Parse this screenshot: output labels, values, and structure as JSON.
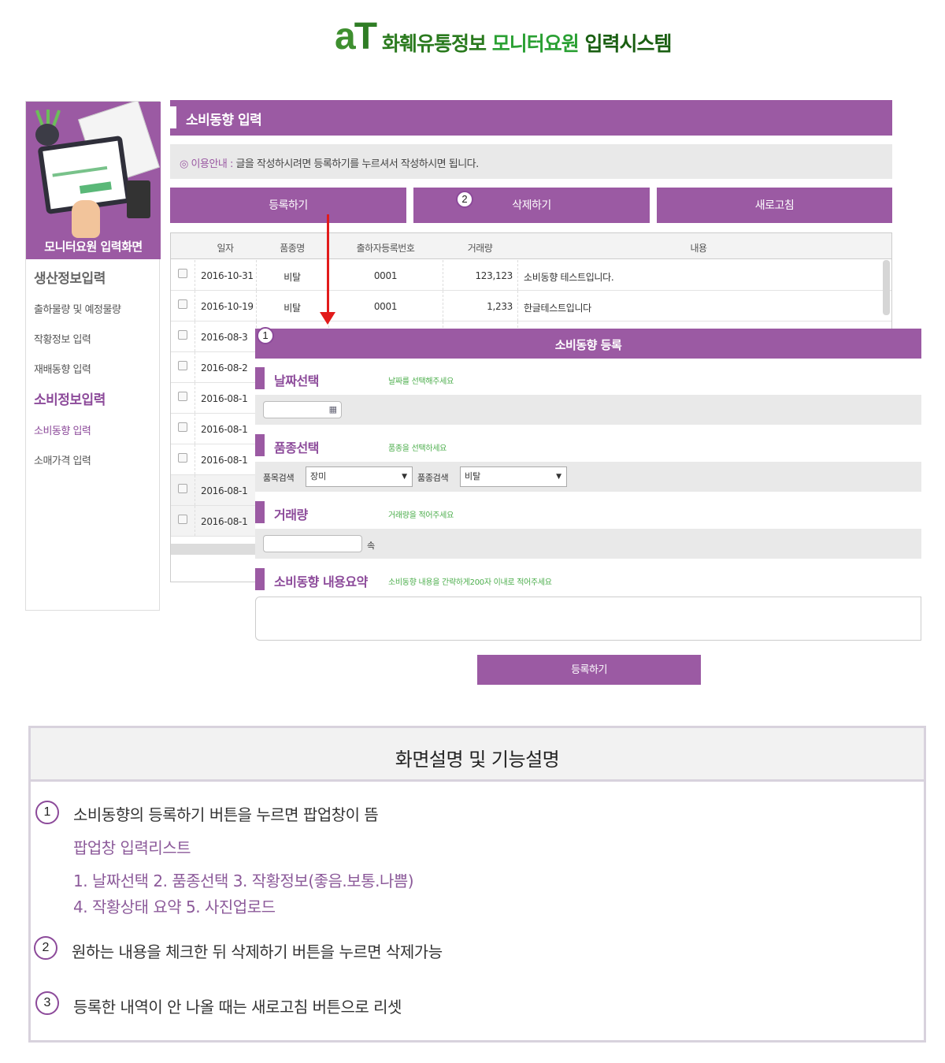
{
  "header": {
    "logo_mark_a": "a",
    "logo_mark_t": "T",
    "title_part1": "화훼유통정보 ",
    "title_part2": "모니터요원",
    "title_part3": " 입력시스템"
  },
  "sidebar": {
    "banner_title": "모니터요원 입력화면",
    "groups": [
      {
        "label": "생산정보입력",
        "items": [
          "출하물량 및 예정물량",
          "작황정보 입력",
          "재배동향 입력"
        ]
      },
      {
        "label": "소비정보입력",
        "items": [
          "소비동향 입력",
          "소매가격 입력"
        ]
      }
    ]
  },
  "main": {
    "title": "소비동향 입력",
    "notice_label": "◎ 이용안내 : ",
    "notice_text": "글을 작성하시려면 등록하기를 누르셔서 작성하시면 됩니다.",
    "buttons": {
      "register": "등록하기",
      "delete": "삭제하기",
      "refresh": "새로고침"
    },
    "table": {
      "headers": [
        "일자",
        "품종명",
        "출하자등록번호",
        "거래량",
        "내용"
      ],
      "rows": [
        {
          "date": "2016-10-31",
          "variety": "비탈",
          "shipper_no": "0001",
          "volume": "123,123",
          "content": "소비동향 테스트입니다."
        },
        {
          "date": "2016-10-19",
          "variety": "비탈",
          "shipper_no": "0001",
          "volume": "1,233",
          "content": "한글테스트입니다"
        },
        {
          "date": "2016-08-3",
          "variety": "",
          "shipper_no": "",
          "volume": "",
          "content": ""
        },
        {
          "date": "2016-08-2",
          "variety": "",
          "shipper_no": "",
          "volume": "",
          "content": ""
        },
        {
          "date": "2016-08-1",
          "variety": "",
          "shipper_no": "",
          "volume": "",
          "content": ""
        },
        {
          "date": "2016-08-1",
          "variety": "",
          "shipper_no": "",
          "volume": "",
          "content": ""
        },
        {
          "date": "2016-08-1",
          "variety": "",
          "shipper_no": "",
          "volume": "",
          "content": ""
        },
        {
          "date": "2016-08-1",
          "variety": "",
          "shipper_no": "",
          "volume": "",
          "content": ""
        },
        {
          "date": "2016-08-1",
          "variety": "",
          "shipper_no": "",
          "volume": "",
          "content": ""
        }
      ]
    }
  },
  "popup": {
    "title": "소비동향 등록",
    "date_section": {
      "title": "날짜선택",
      "hint": "날짜를 선택해주세요",
      "value": ""
    },
    "variety_section": {
      "title": "품종선택",
      "hint": "품종을 선택하세요",
      "item_search_label": "품목검색",
      "item_value": "장미",
      "variety_search_label": "품종검색",
      "variety_value": "비탈"
    },
    "volume_section": {
      "title": "거래량",
      "hint": "거래량을 적어주세요",
      "unit": "속",
      "value": ""
    },
    "summary_section": {
      "title": "소비동향 내용요약",
      "hint": "소비동향 내용을 간략하게200자 이내로 적어주세요",
      "value": ""
    },
    "submit_label": "등록하기"
  },
  "annotations": {
    "badge1": "1",
    "badge2": "2",
    "badge3": "3"
  },
  "description": {
    "title": "화면설명 및 기능설명",
    "item1": "소비동향의 등록하기 버튼을 누르면 팝업창이 뜸",
    "item1_sub_title": "팝업창 입력리스트",
    "item1_sub_line1": "1. 날짜선택 2. 품종선택 3. 작황정보(좋음.보통.나쁨)",
    "item1_sub_line2": "4. 작황상태 요약 5. 사진업로드",
    "item2": "원하는 내용을 체크한 뒤 삭제하기 버튼을 누르면 삭제가능",
    "item3": "등록한 내역이 안 나올 때는 새로고침 버튼으로 리셋"
  },
  "colors": {
    "accent_purple": "#9b5aa3",
    "brand_green": "#2a7a1e",
    "hint_green": "#4cae4c",
    "arrow_red": "#e21b1b"
  }
}
